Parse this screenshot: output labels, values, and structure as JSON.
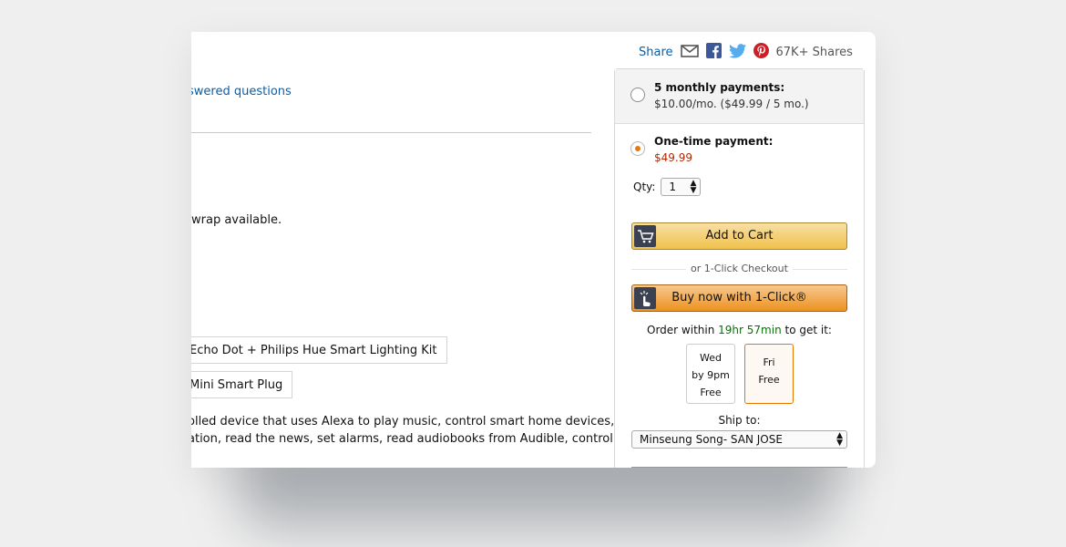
{
  "left": {
    "answered_questions": "swered questions",
    "gift_wrap": "wrap available.",
    "bundle_options": [
      "Echo Dot + Philips Hue Smart Lighting Kit",
      "Mini Smart Plug"
    ],
    "description_lines": [
      "olled device that uses Alexa to play music, control smart home devices,",
      "ation, read the news, set alarms, read audiobooks from Audible, control"
    ]
  },
  "share": {
    "label": "Share",
    "count": "67K+ Shares",
    "icons": [
      "email-icon",
      "facebook-icon",
      "twitter-icon",
      "pinterest-icon"
    ]
  },
  "buybox": {
    "monthly": {
      "title": "5 monthly payments:",
      "detail": "$10.00/mo. ($49.99 / 5 mo.)"
    },
    "onetime": {
      "title": "One-time payment:",
      "price": "$49.99"
    },
    "qty": {
      "label": "Qty:",
      "value": "1"
    },
    "add_to_cart": "Add to Cart",
    "or_checkout": "or 1-Click Checkout",
    "buy_now": "Buy now with 1-Click®",
    "order": {
      "prefix": "Order within ",
      "time": "19hr 57min",
      "suffix": " to get it:"
    },
    "delivery": [
      {
        "line1": "Wed",
        "line2": "by 9pm",
        "line3": "Free"
      },
      {
        "line1": "Fri",
        "line2": "Free"
      }
    ],
    "ship_label": "Ship to:",
    "ship_value": "Minseung Song- SAN JOSE"
  },
  "colors": {
    "accent_orange": "#e47911",
    "price_red": "#b12704",
    "link_blue": "#0a5ea8",
    "green": "#007600"
  }
}
